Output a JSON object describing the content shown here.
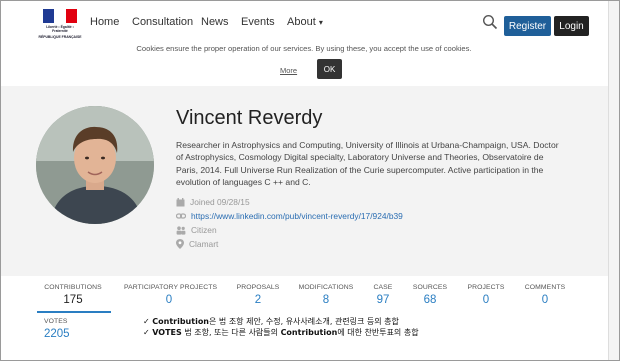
{
  "nav": {
    "logo_lines": [
      "Liberté • Égalité • Fraternité",
      "RÉPUBLIQUE FRANÇAISE"
    ],
    "links": [
      "Home",
      "Consultation",
      "News",
      "Events",
      "About"
    ],
    "about_caret": "▾",
    "register_label": "Register",
    "login_label": "Login"
  },
  "cookies": {
    "text": "Cookies ensure the proper operation of our services. By using these, you accept the use of cookies.",
    "more_label": "More",
    "ok_label": "OK"
  },
  "profile": {
    "name": "Vincent Reverdy",
    "bio": "Researcher in Astrophysics and Computing, University of Illinois at Urbana-Champaign, USA. Doctor of Astrophysics, Cosmology Digital specialty, Laboratory Universe and Theories, Observatoire de Paris, 2014. Full Universe Run Realization of the Curie supercomputer. Active participation in the evolution of languages C ++ and C.",
    "joined": "Joined 09/28/15",
    "link": "https://www.linkedin.com/pub/vincent-reverdy/17/924/b39",
    "role": "Citizen",
    "location": "Clamart"
  },
  "stats": [
    {
      "label": "CONTRIBUTIONS",
      "value": "175"
    },
    {
      "label": "PARTICIPATORY PROJECTS",
      "value": "0"
    },
    {
      "label": "PROPOSALS",
      "value": "2"
    },
    {
      "label": "MODIFICATIONS",
      "value": "8"
    },
    {
      "label": "CASE",
      "value": "97"
    },
    {
      "label": "SOURCES",
      "value": "68"
    },
    {
      "label": "PROJECTS",
      "value": "0"
    },
    {
      "label": "COMMENTS",
      "value": "0"
    }
  ],
  "votes": {
    "label": "VOTES",
    "value": "2205"
  },
  "notes": {
    "line1_bold": "Contribution",
    "line1_rest": "은 법 조항 제안, 수정, 유사사례소개, 관련링크 등의 총합",
    "line2_bold": "VOTES",
    "line2_mid": " 법 조항, 또는 다른 사람들의 ",
    "line2_bold2": "Contribution",
    "line2_rest": "에 대한 찬반투표의 총합"
  },
  "colors": {
    "accent": "#2a7ec2",
    "register": "#1f5f99",
    "login": "#222222",
    "profile_bg": "#f3f3f3"
  }
}
